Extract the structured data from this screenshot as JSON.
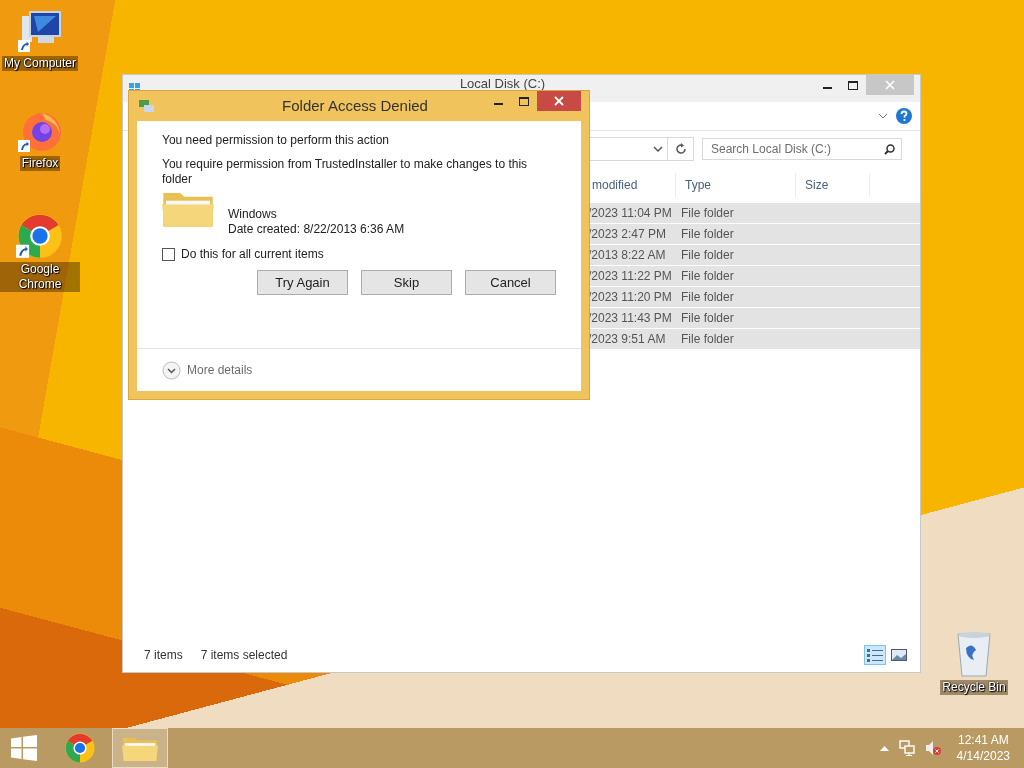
{
  "desktop_icons": [
    {
      "kind": "computer",
      "label": "My Computer"
    },
    {
      "kind": "firefox",
      "label": "Firefox"
    },
    {
      "kind": "chrome",
      "label": "Google Chrome"
    },
    {
      "kind": "recycle",
      "label": "Recycle Bin"
    }
  ],
  "explorer": {
    "title": "Local Disk (C:)",
    "search": {
      "placeholder": "Search Local Disk (C:)"
    },
    "columns": [
      "modified",
      "Type",
      "Size"
    ],
    "rows": [
      {
        "date": "/2023 11:04 PM",
        "type": "File folder",
        "selected": true
      },
      {
        "date": "/2023 2:47 PM",
        "type": "File folder",
        "selected": true
      },
      {
        "date": "/2013 8:22 AM",
        "type": "File folder",
        "selected": true
      },
      {
        "date": "/2023 11:22 PM",
        "type": "File folder",
        "selected": true
      },
      {
        "date": "/2023 11:20 PM",
        "type": "File folder",
        "selected": true
      },
      {
        "date": "/2023 11:43 PM",
        "type": "File folder",
        "selected": true
      },
      {
        "date": "/2023 9:51 AM",
        "type": "File folder",
        "selected": true
      }
    ],
    "status": {
      "count": "7 items",
      "selection": "7 items selected"
    },
    "views": [
      {
        "kind": "details",
        "selected": true
      },
      {
        "kind": "thumbnails",
        "selected": false
      }
    ]
  },
  "dialog": {
    "title": "Folder Access Denied",
    "heading": "You need permission to perform this action",
    "message": "You require permission from TrustedInstaller to make changes to this folder",
    "item": {
      "name": "Windows",
      "date": "Date created: 8/22/2013 6:36 AM"
    },
    "checkbox": {
      "label": "Do this for all current items",
      "checked": false
    },
    "buttons": [
      "Try Again",
      "Skip",
      "Cancel"
    ],
    "more_details": "More details"
  },
  "taskbar": {
    "apps": [
      {
        "kind": "chrome",
        "selected": false
      },
      {
        "kind": "explorer",
        "selected": true
      }
    ],
    "clock": {
      "time": "12:41 AM",
      "date": "4/14/2023"
    }
  }
}
